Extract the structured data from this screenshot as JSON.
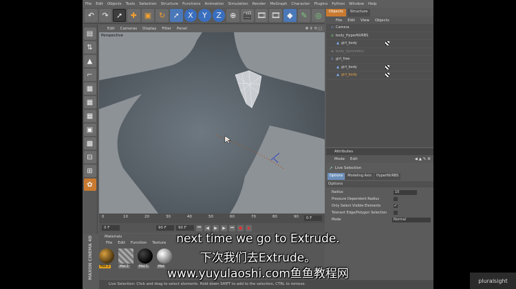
{
  "menubar": [
    "File",
    "Edit",
    "Objects",
    "Tools",
    "Selection",
    "Structure",
    "Functions",
    "Animation",
    "Simulation",
    "Render",
    "MoGraph",
    "Character",
    "Plugins",
    "Python",
    "Window",
    "Help"
  ],
  "toolbar_icons": [
    "undo-icon",
    "redo-icon",
    "live-selection-icon",
    "move-icon",
    "scale-icon",
    "rotate-icon",
    "last-tool-icon",
    "x-axis-icon",
    "y-axis-icon",
    "z-axis-icon",
    "coordinate-system-icon",
    "render-view-icon",
    "render-picture-viewer-icon",
    "render-settings-icon",
    "cube-icon",
    "pen-icon",
    "subdivision-icon",
    "cloner-icon",
    "deformer-icon",
    "scene-icon",
    "camera-icon",
    "light-icon"
  ],
  "viewport": {
    "menu": [
      "Edit",
      "Cameras",
      "Display",
      "Filter",
      "Panel"
    ],
    "label": "Perspective"
  },
  "timeline": {
    "ticks": [
      "0",
      "10",
      "20",
      "30",
      "40",
      "50",
      "60",
      "70",
      "80",
      "90"
    ],
    "current": "0 F",
    "start": "0 F",
    "end": "90 F",
    "fps_field": "90 F"
  },
  "materials": {
    "title": "Materials",
    "menu": [
      "File",
      "Edit",
      "Function",
      "Texture"
    ],
    "items": [
      {
        "label": "Mat.3"
      },
      {
        "label": "Mat.2"
      },
      {
        "label": "Mat.1"
      },
      {
        "label": "Mat"
      }
    ]
  },
  "brand_vertical": "MAXON CINEMA 4D",
  "status": "Live Selection: Click and drag to select elements. Hold down SHIFT to add to the selection, CTRL to remove.",
  "objects_panel": {
    "tabs": [
      "Objects",
      "Structure"
    ],
    "menu": [
      "File",
      "Edit",
      "View",
      "Objects"
    ],
    "rows": [
      {
        "name": "Camera",
        "style": "normal",
        "indent": 1
      },
      {
        "name": "body_HyperNURBS",
        "style": "normal",
        "indent": 1
      },
      {
        "name": "girl_body",
        "style": "normal",
        "indent": 2
      },
      {
        "name": "body_Symmetry",
        "style": "dim",
        "indent": 1
      },
      {
        "name": "girl_free",
        "style": "normal",
        "indent": 1
      },
      {
        "name": "girl_body",
        "style": "normal",
        "indent": 2
      },
      {
        "name": "girl_body",
        "style": "highlight",
        "indent": 2
      }
    ]
  },
  "attributes": {
    "header": "Attributes",
    "menu": [
      "Mode",
      "Edit"
    ],
    "tool_name": "Live Selection",
    "tabs": [
      "Options",
      "Modeling Axis",
      "HyperNURBS"
    ],
    "section": "Options",
    "rows": [
      {
        "label": "Radius",
        "value": "10"
      },
      {
        "label": "Pressure Dependent Radius",
        "value": ""
      },
      {
        "label": "Only Select Visible Elements",
        "value": "✓"
      },
      {
        "label": "Tolerant Edge/Polygon Selection",
        "value": ""
      },
      {
        "label": "Mode",
        "value": "Normal"
      }
    ]
  },
  "subtitles": {
    "en": "next time we go to Extrude.",
    "zh": "下次我们去Extrude。",
    "watermark": "www.yuyulaoshi.com鱼鱼教程网"
  },
  "corner_logo": "pluralsight"
}
